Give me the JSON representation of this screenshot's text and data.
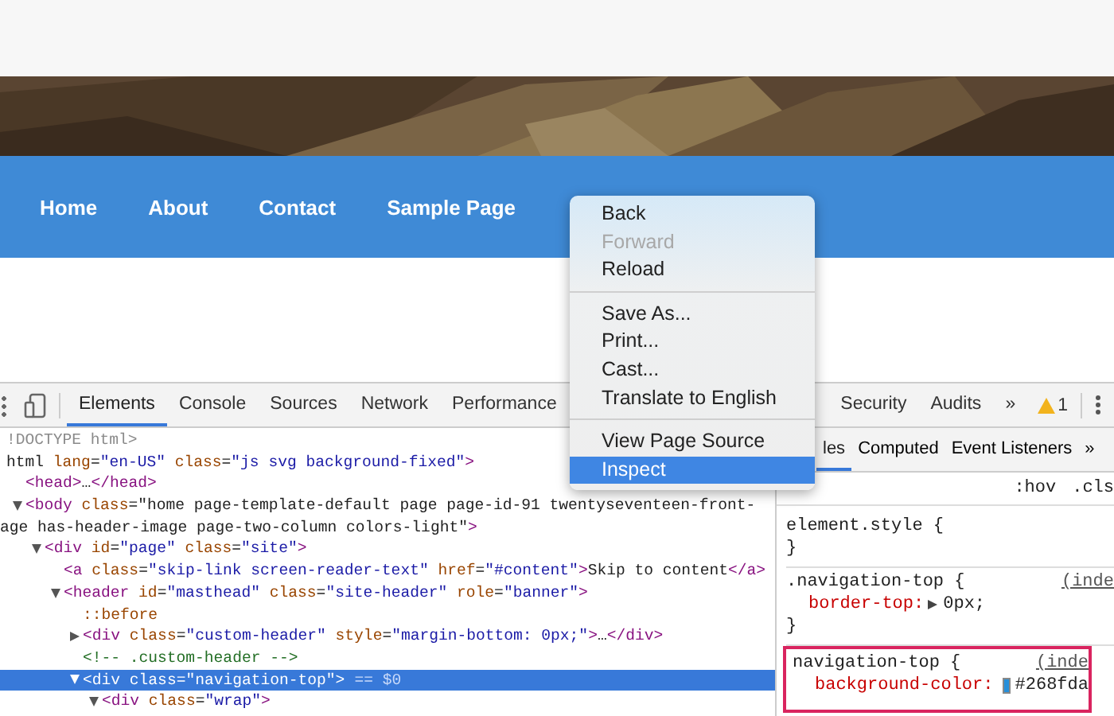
{
  "site": {
    "nav": [
      "Home",
      "About",
      "Contact",
      "Sample Page"
    ]
  },
  "context_menu": [
    {
      "kind": "item",
      "label": "Back",
      "disabled": false,
      "selected": false
    },
    {
      "kind": "item",
      "label": "Forward",
      "disabled": true,
      "selected": false
    },
    {
      "kind": "item",
      "label": "Reload",
      "disabled": false,
      "selected": false
    },
    {
      "kind": "separator"
    },
    {
      "kind": "item",
      "label": "Save As...",
      "disabled": false,
      "selected": false
    },
    {
      "kind": "item",
      "label": "Print...",
      "disabled": false,
      "selected": false
    },
    {
      "kind": "item",
      "label": "Cast...",
      "disabled": false,
      "selected": false
    },
    {
      "kind": "item",
      "label": "Translate to English",
      "disabled": false,
      "selected": false
    },
    {
      "kind": "separator"
    },
    {
      "kind": "item",
      "label": "View Page Source",
      "disabled": false,
      "selected": false
    },
    {
      "kind": "item",
      "label": "Inspect",
      "disabled": false,
      "selected": true
    }
  ],
  "devtools": {
    "tabs": [
      {
        "label": "Elements",
        "selected": true
      },
      {
        "label": "Console",
        "selected": false
      },
      {
        "label": "Sources",
        "selected": false
      },
      {
        "label": "Network",
        "selected": false
      },
      {
        "label": "Performance",
        "selected": false
      }
    ],
    "tabs_right": [
      {
        "label": "Security",
        "selected": false
      },
      {
        "label": "Audits",
        "selected": false
      },
      {
        "label": "»",
        "selected": false
      }
    ],
    "warnings": "1",
    "elements": [
      {
        "kind": "doctype",
        "text": "!DOCTYPE html>"
      },
      {
        "kind": "element",
        "text": "html lang=\"en-US\" class=\"js svg background-fixed\">",
        "children": [
          {
            "kind": "element",
            "text": "<head>…</head>"
          },
          {
            "kind": "element",
            "text": "<body class=\"home page-template-default page page-id-91 twentyseventeen-front-",
            "continuation": "age has-header-image page-two-column colors-light\">",
            "expanded": true,
            "children": [
              {
                "kind": "element",
                "text": "<div id=\"page\" class=\"site\">",
                "expanded": true,
                "children": [
                  {
                    "kind": "element",
                    "text": "<a class=\"skip-link screen-reader-text\" href=\"#content\">Skip to content</a>"
                  },
                  {
                    "kind": "element",
                    "text": "<header id=\"masthead\" class=\"site-header\" role=\"banner\">",
                    "expanded": true,
                    "children": [
                      {
                        "kind": "pseudo",
                        "text": "::before"
                      },
                      {
                        "kind": "element",
                        "text": "<div class=\"custom-header\" style=\"margin-bottom: 0px;\">…</div>",
                        "expanded": false
                      },
                      {
                        "kind": "comment",
                        "text": "<!-- .custom-header -->"
                      },
                      {
                        "kind": "element",
                        "text": "<div class=\"navigation-top\">",
                        "marker": "== $0",
                        "expanded": true,
                        "selected": true,
                        "children": [
                          {
                            "kind": "element",
                            "text": "<div class=\"wrap\">",
                            "expanded": true
                          }
                        ]
                      }
                    ]
                  }
                ]
              }
            ]
          }
        ]
      }
    ],
    "sidebar_tabs": [
      {
        "label": "les",
        "selected": true
      },
      {
        "label": "Computed",
        "selected": false
      },
      {
        "label": "Event Listeners",
        "selected": false
      },
      {
        "label": "»",
        "selected": false
      }
    ],
    "filter_buttons": [
      ":hov",
      ".cls"
    ],
    "rules": [
      {
        "selector": "element.style {",
        "close": "}"
      },
      {
        "selector": ".navigation-top {",
        "source": "(inde",
        "close": "}",
        "properties": [
          {
            "name": "border-top:",
            "value": "0px;",
            "expandable": true
          }
        ]
      },
      {
        "selector": "navigation-top {",
        "source": "(inde",
        "highlighted": true,
        "properties": [
          {
            "name": "background-color:",
            "value": "#268fda",
            "color": "#268fda"
          }
        ]
      }
    ]
  }
}
